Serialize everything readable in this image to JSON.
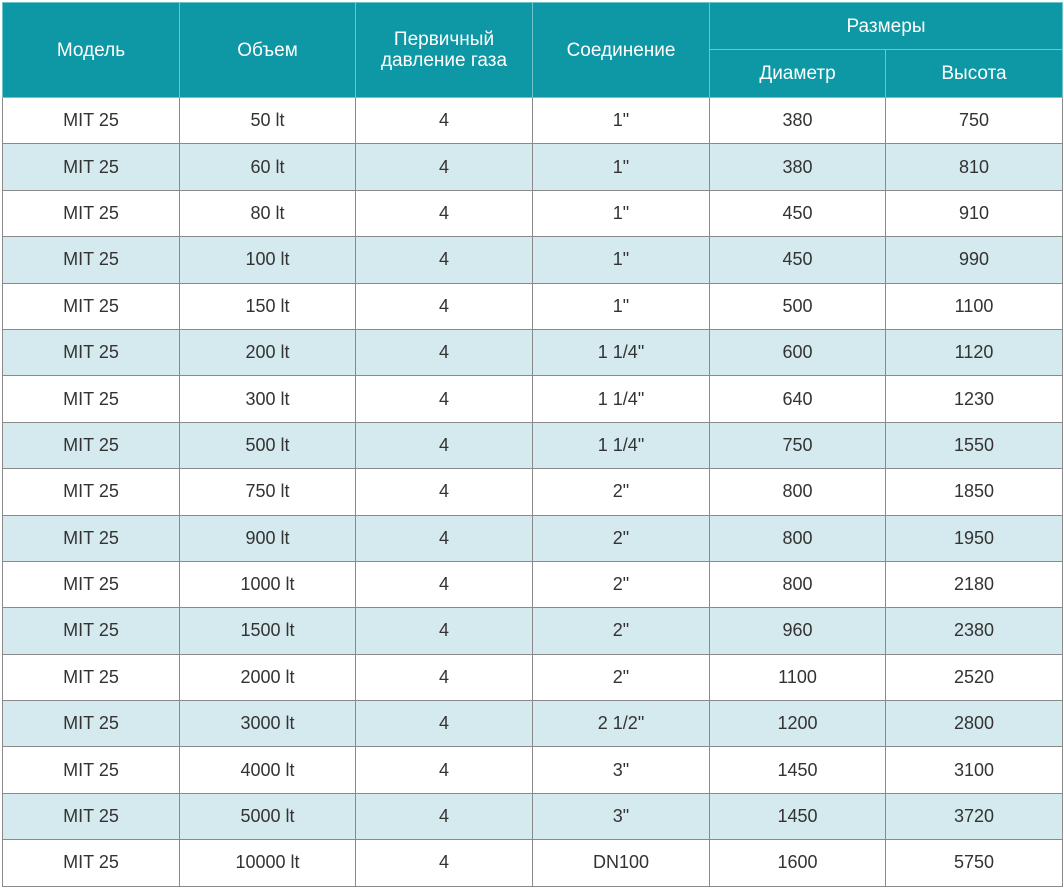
{
  "colors": {
    "header_bg": "#0e97a4",
    "header_text": "#ffffff",
    "row_alt_bg": "#d5eaef",
    "row_bg": "#ffffff",
    "border": "#8a8a8a"
  },
  "table": {
    "headers": {
      "model": "Модель",
      "volume": "Объем",
      "pressure_line1": "Первичный",
      "pressure_line2": "давление газа",
      "connection": "Соединение",
      "dimensions": "Размеры",
      "diameter": "Диаметр",
      "height": "Высота"
    },
    "rows": [
      [
        "MIT 25",
        "50 lt",
        "4",
        "1\"",
        "380",
        "750"
      ],
      [
        "MIT 25",
        "60 lt",
        "4",
        "1\"",
        "380",
        "810"
      ],
      [
        "MIT 25",
        "80 lt",
        "4",
        "1\"",
        "450",
        "910"
      ],
      [
        "MIT 25",
        "100 lt",
        "4",
        "1\"",
        "450",
        "990"
      ],
      [
        "MIT 25",
        "150 lt",
        "4",
        "1\"",
        "500",
        "1100"
      ],
      [
        "MIT 25",
        "200 lt",
        "4",
        "1 1/4\"",
        "600",
        "1120"
      ],
      [
        "MIT 25",
        "300 lt",
        "4",
        "1 1/4\"",
        "640",
        "1230"
      ],
      [
        "MIT 25",
        "500 lt",
        "4",
        "1 1/4\"",
        "750",
        "1550"
      ],
      [
        "MIT 25",
        "750 lt",
        "4",
        "2\"",
        "800",
        "1850"
      ],
      [
        "MIT 25",
        "900 lt",
        "4",
        "2\"",
        "800",
        "1950"
      ],
      [
        "MIT 25",
        "1000 lt",
        "4",
        "2\"",
        "800",
        "2180"
      ],
      [
        "MIT 25",
        "1500 lt",
        "4",
        "2\"",
        "960",
        "2380"
      ],
      [
        "MIT 25",
        "2000 lt",
        "4",
        "2\"",
        "1100",
        "2520"
      ],
      [
        "MIT 25",
        "3000 lt",
        "4",
        "2 1/2\"",
        "1200",
        "2800"
      ],
      [
        "MIT 25",
        "4000 lt",
        "4",
        "3\"",
        "1450",
        "3100"
      ],
      [
        "MIT 25",
        "5000 lt",
        "4",
        "3\"",
        "1450",
        "3720"
      ],
      [
        "MIT 25",
        "10000 lt",
        "4",
        "DN100",
        "1600",
        "5750"
      ]
    ]
  }
}
